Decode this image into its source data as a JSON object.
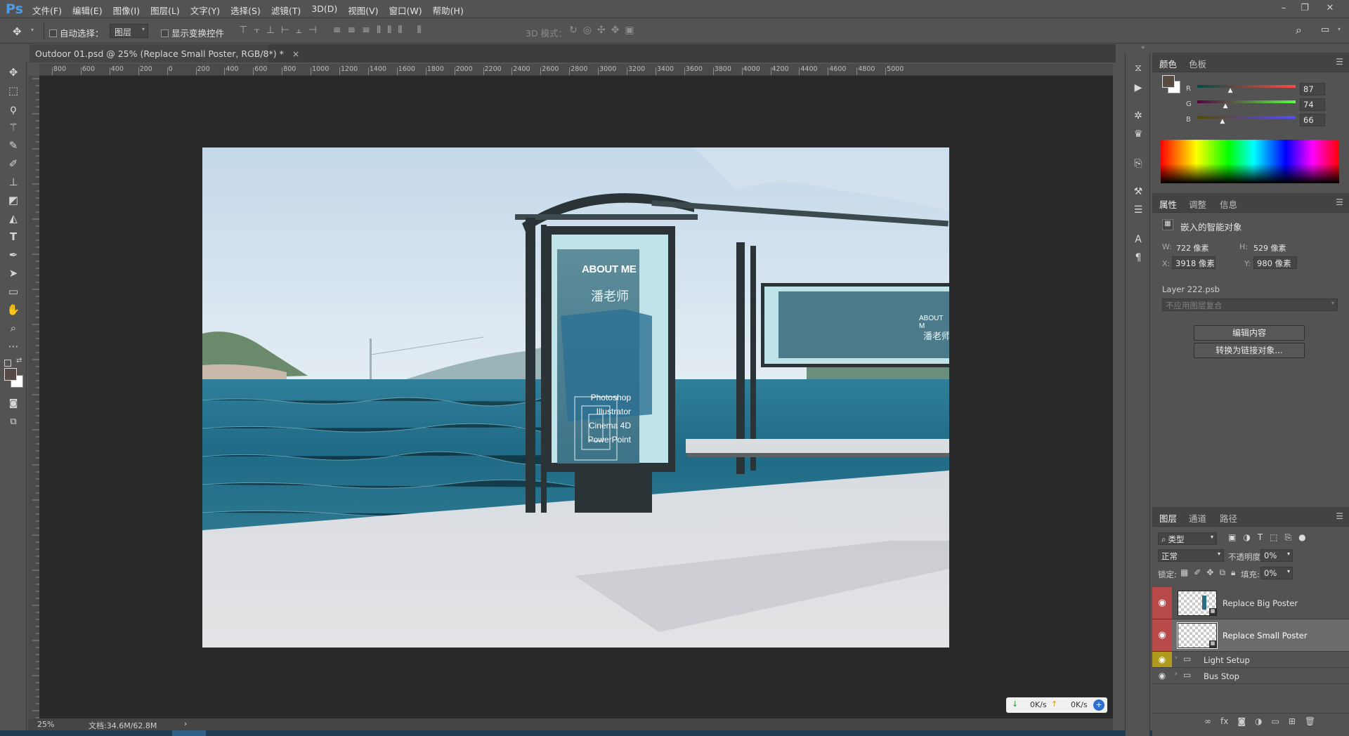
{
  "app": {
    "logo": "Ps"
  },
  "menu": [
    "文件(F)",
    "编辑(E)",
    "图像(I)",
    "图层(L)",
    "文字(Y)",
    "选择(S)",
    "滤镜(T)",
    "3D(D)",
    "视图(V)",
    "窗口(W)",
    "帮助(H)"
  ],
  "options": {
    "auto_select_label": "自动选择：",
    "auto_select_value": "图层",
    "show_transform_label": "显示变换控件",
    "mode_3d_label": "3D 模式："
  },
  "document": {
    "tab_title": "Outdoor 01.psd @ 25% (Replace Small Poster, RGB/8*) *",
    "close": "×"
  },
  "ruler_top": [
    "800",
    "600",
    "400",
    "200",
    "0",
    "200",
    "400",
    "600",
    "800",
    "1000",
    "1200",
    "1400",
    "1600",
    "1800",
    "2000",
    "2200",
    "2400",
    "2600",
    "2800",
    "3000",
    "3200",
    "3400",
    "3600",
    "3800",
    "4000",
    "4200",
    "4400",
    "4600",
    "4800",
    "5000"
  ],
  "poster": {
    "title": "ABOUT ME",
    "name": "潘老师",
    "skills": [
      "Photoshop",
      "Illustrator",
      "Cinema 4D",
      "PowerPoint"
    ],
    "side_title": "ABOUT M",
    "side_name": "潘老师"
  },
  "status": {
    "zoom": "25%",
    "doc": "文档:34.6M/62.8M",
    "arrow": "›"
  },
  "network": {
    "down": "0K/s",
    "up": "0K/s"
  },
  "color_panel": {
    "tabs": [
      "颜色",
      "色板"
    ],
    "r_label": "R",
    "g_label": "G",
    "b_label": "B",
    "r": "87",
    "g": "74",
    "b": "66",
    "r_level": 0.34,
    "g_level": 0.29,
    "b_level": 0.26,
    "fg_color": "#574a42"
  },
  "properties": {
    "tabs": [
      "属性",
      "调整",
      "信息"
    ],
    "type": "嵌入的智能对象",
    "w_label": "W:",
    "w": "722 像素",
    "h_label": "H:",
    "h": "529 像素",
    "x_label": "X:",
    "x": "3918 像素",
    "y_label": "Y:",
    "y": "980 像素",
    "file": "Layer 222.psb",
    "comp": "不应用图层复合",
    "edit_btn": "编辑内容",
    "convert_btn": "转换为链接对象..."
  },
  "layers_panel": {
    "tabs": [
      "图层",
      "通道",
      "路径"
    ],
    "filter": "类型",
    "blend": "正常",
    "opacity_label": "不透明度:",
    "opacity": "0%",
    "lock_label": "锁定:",
    "fill_label": "填充:",
    "fill": "0%",
    "layers": [
      {
        "name": "Replace Big Poster"
      },
      {
        "name": "Replace Small Poster"
      },
      {
        "name": "Light Setup"
      },
      {
        "name": "Bus Stop"
      }
    ]
  },
  "colors": {
    "accent": "#2f5f86",
    "eye_red": "#b84a4a",
    "eye_yellow": "#b09a1e"
  }
}
